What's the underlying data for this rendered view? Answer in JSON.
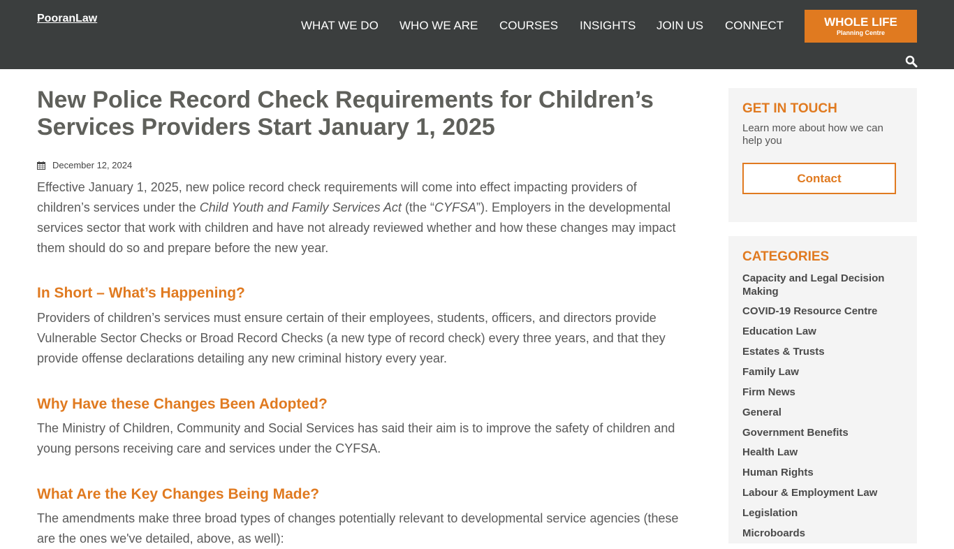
{
  "header": {
    "logo_alt": "PooranLaw",
    "nav": [
      "WHAT WE DO",
      "WHO WE ARE",
      "COURSES",
      "INSIGHTS",
      "JOIN US",
      "CONNECT"
    ],
    "cta_line1": "WHOLE LIFE",
    "cta_line2": "Planning Centre",
    "search_icon": "search-icon"
  },
  "colors": {
    "header_bg": "#3b3e3e",
    "accent": "#e07a20",
    "title": "#5f605b",
    "body_text": "#5a5a5a",
    "card_bg": "#f4f4f4"
  },
  "article": {
    "title": "New Police Record Check Requirements for Children’s Services Providers Start January 1, 2025",
    "date": "December 12, 2024",
    "p1_a": "Effective January 1, 2025, new police record check requirements will come into effect impacting providers of children’s services under the ",
    "p1_italic1": "Child Youth and Family Services Act",
    "p1_b": " (the “",
    "p1_italic2": "CYFSA",
    "p1_c": "”). Employers in the developmental services sector that work with children and have not already reviewed whether and how these changes may impact them should do so and prepare before the new year.",
    "h_short": "In Short – What’s Happening?",
    "p2": "Providers of children’s services must ensure certain of their employees, students, officers, and directors provide Vulnerable Sector Checks or Broad Record Checks (a new type of record check) every three years, and that they provide offense declarations detailing any new criminal history every year.",
    "h_why": "Why Have these Changes Been Adopted?",
    "p3": "The Ministry of Children, Community and Social Services has said their aim is to improve the safety of children and young persons receiving care and services under the CYFSA.",
    "h_key": "What Are the Key Changes Being Made?",
    "p4": "The amendments make three broad types of changes potentially relevant to developmental service agencies (these are the ones we've detailed, above, as well):"
  },
  "sidebar": {
    "touch_title": "GET IN TOUCH",
    "touch_sub": "Learn more about how we can help you",
    "contact_label": "Contact",
    "categories_title": "CATEGORIES",
    "categories": [
      "Capacity and Legal Decision Making",
      "COVID-19 Resource Centre",
      "Education Law",
      "Estates & Trusts",
      "Family Law",
      "Firm News",
      "General",
      "Government Benefits",
      "Health Law",
      "Human Rights",
      "Labour & Employment Law",
      "Legislation",
      "Microboards"
    ]
  }
}
